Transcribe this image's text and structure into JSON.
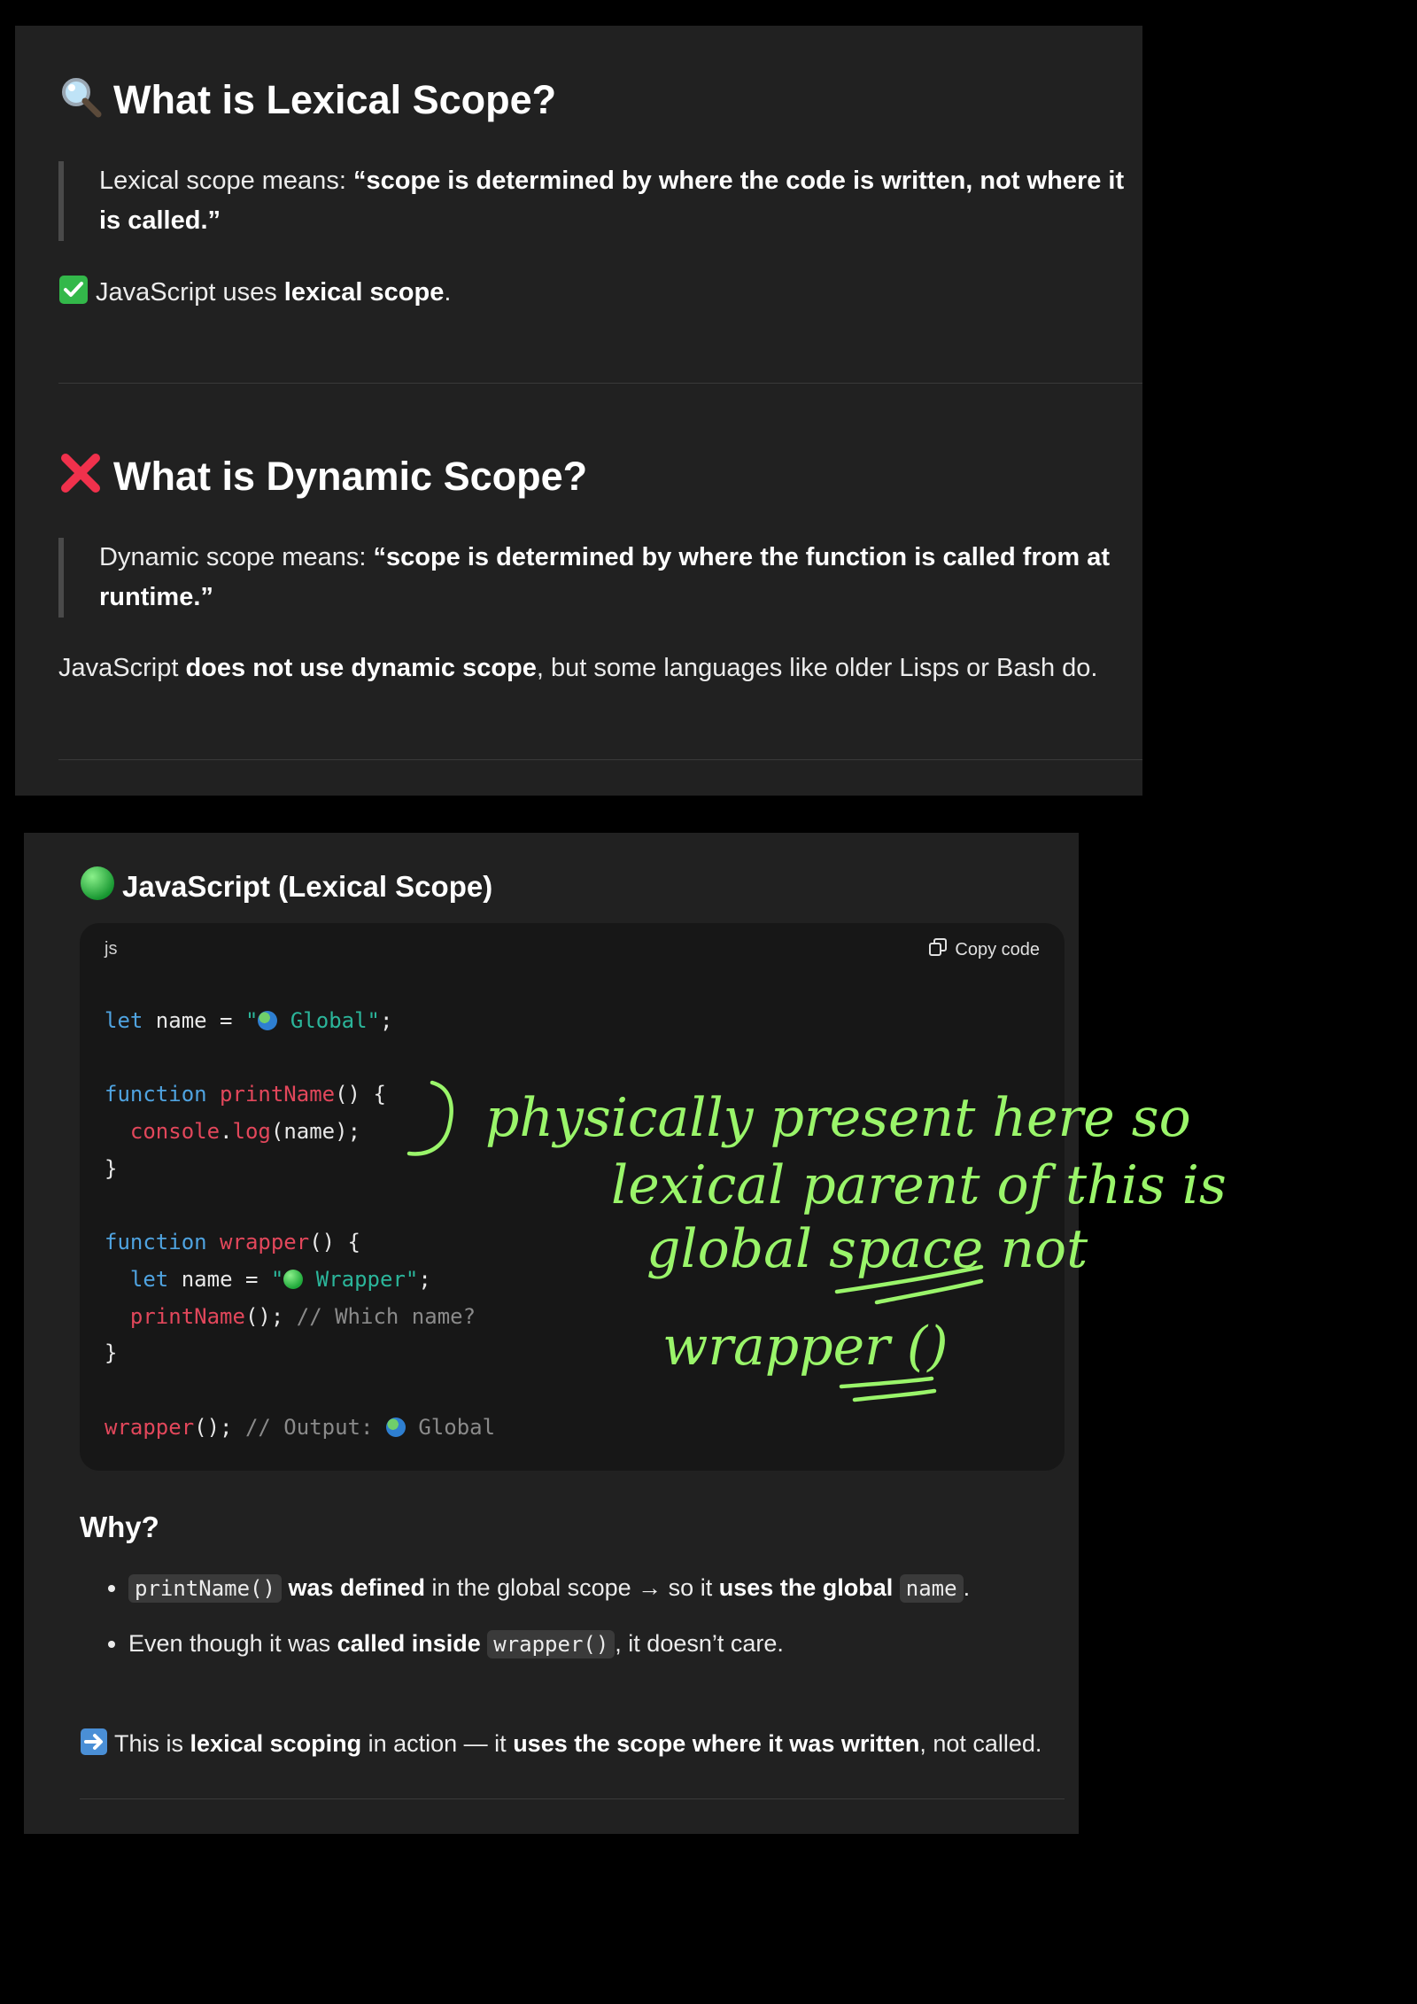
{
  "section_lexical": {
    "heading": "What is Lexical Scope?",
    "quote_intro": "Lexical scope means: ",
    "quote_bold": "“scope is determined by where the code is written, not where it is called.”",
    "note_prefix": "JavaScript uses ",
    "note_bold": "lexical scope",
    "note_suffix": "."
  },
  "section_dynamic": {
    "heading": "What is Dynamic Scope?",
    "quote_intro": "Dynamic scope means: ",
    "quote_bold": "“scope is determined by where the function is called from at runtime.”",
    "note_prefix": "JavaScript ",
    "note_bold": "does not use dynamic scope",
    "note_suffix": ", but some languages like older Lisps or Bash do."
  },
  "example": {
    "heading": "JavaScript (Lexical Scope)",
    "code_language": "js",
    "copy_label": "Copy code",
    "code": {
      "l1_kw": "let",
      "l1_rest": " name = ",
      "l1_str_open": "\"",
      "l1_str_text": " Global\"",
      "l1_end": ";",
      "l3_kw": "function",
      "l3_fn": "printName",
      "l3_rest": "() {",
      "l4_obj": "console",
      "l4_dot": ".",
      "l4_fn": "log",
      "l4_rest": "(name);",
      "l5": "}",
      "l7_kw": "function",
      "l7_fn": "wrapper",
      "l7_rest": "() {",
      "l8_kw": "let",
      "l8_rest": " name = ",
      "l8_str_open": "\"",
      "l8_str_text": " Wrapper\"",
      "l8_end": ";",
      "l9_fn": "printName",
      "l9_rest": "(); ",
      "l9_cm": "// Which name?",
      "l10": "}",
      "l12_fn": "wrapper",
      "l12_rest": "(); ",
      "l12_cm": "// Output: ",
      "l12_cm_end": " Global"
    },
    "why_heading": "Why?",
    "bullet1": {
      "code": "printName()",
      "bold1": "was defined",
      "mid": " in the global scope → so it ",
      "bold2": "uses the global",
      "code2": "name",
      "end": "."
    },
    "bullet2": {
      "prefix": "Even though it was ",
      "bold": "called inside",
      "code": "wrapper()",
      "end": ", it doesn’t care."
    },
    "summary": {
      "prefix": " This is ",
      "bold1": "lexical scoping",
      "mid": " in action — it ",
      "bold2": "uses the scope where it was written",
      "end": ", not called."
    }
  },
  "handwriting": {
    "line1": "physically present here so",
    "line2": "lexical parent of this is",
    "line3": "global space  not",
    "line4": "wrapper ()"
  },
  "colors": {
    "background": "#000000",
    "panel": "#212121",
    "code_bg": "#171717",
    "keyword": "#4fa3e0",
    "function": "#e2475b",
    "string": "#2bb59a",
    "comment": "#8a8a8a",
    "ink": "#9af56a"
  }
}
